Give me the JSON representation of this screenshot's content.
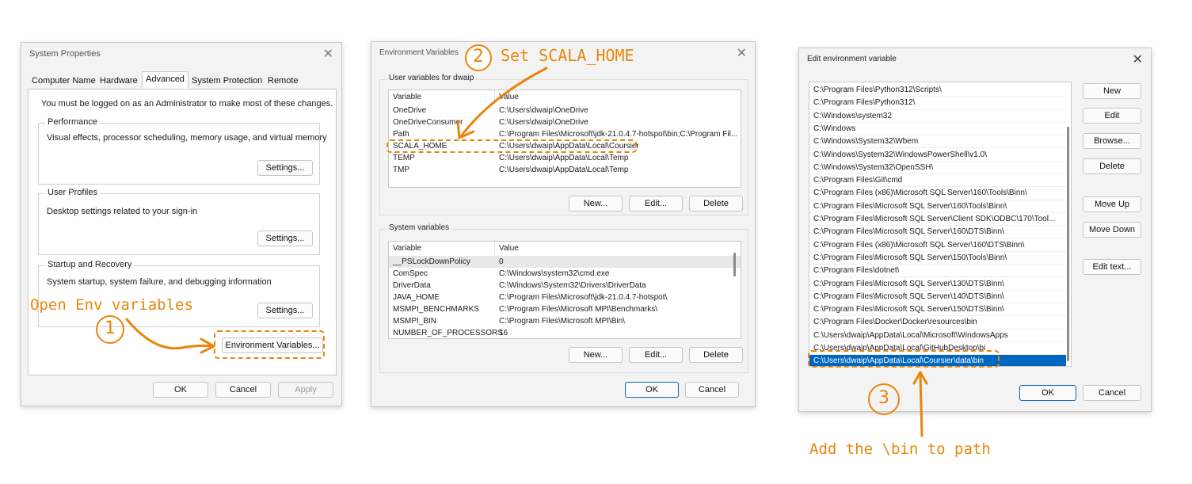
{
  "accent": "#e8860c",
  "select_blue": "#0067c0",
  "sys_props": {
    "title": "System Properties",
    "tabs": [
      "Computer Name",
      "Hardware",
      "Advanced",
      "System Protection",
      "Remote"
    ],
    "active_tab": "Advanced",
    "admin_note": "You must be logged on as an Administrator to make most of these changes.",
    "performance": {
      "label": "Performance",
      "desc": "Visual effects, processor scheduling, memory usage, and virtual memory",
      "button": "Settings..."
    },
    "user_profiles": {
      "label": "User Profiles",
      "desc": "Desktop settings related to your sign-in",
      "button": "Settings..."
    },
    "startup": {
      "label": "Startup and Recovery",
      "desc": "System startup, system failure, and debugging information",
      "button": "Settings..."
    },
    "env_button": "Environment Variables...",
    "ok": "OK",
    "cancel": "Cancel",
    "apply": "Apply"
  },
  "env_vars": {
    "title": "Environment Variables",
    "user_label": "User variables for dwaip",
    "col_var": "Variable",
    "col_val": "Value",
    "user_rows": [
      {
        "name": "OneDrive",
        "value": "C:\\Users\\dwaip\\OneDrive"
      },
      {
        "name": "OneDriveConsumer",
        "value": "C:\\Users\\dwaip\\OneDrive"
      },
      {
        "name": "Path",
        "value": "C:\\Program Files\\Microsoft\\jdk-21.0.4.7-hotspot\\bin;C:\\Program Fil..."
      },
      {
        "name": "SCALA_HOME",
        "value": "C:\\Users\\dwaip\\AppData\\Local\\Coursier"
      },
      {
        "name": "TEMP",
        "value": "C:\\Users\\dwaip\\AppData\\Local\\Temp"
      },
      {
        "name": "TMP",
        "value": "C:\\Users\\dwaip\\AppData\\Local\\Temp"
      }
    ],
    "system_label": "System variables",
    "system_rows": [
      {
        "name": "__PSLockDownPolicy",
        "value": "0"
      },
      {
        "name": "ComSpec",
        "value": "C:\\Windows\\system32\\cmd.exe"
      },
      {
        "name": "DriverData",
        "value": "C:\\Windows\\System32\\Drivers\\DriverData"
      },
      {
        "name": "JAVA_HOME",
        "value": "C:\\Program Files\\Microsoft\\jdk-21.0.4.7-hotspot\\"
      },
      {
        "name": "MSMPI_BENCHMARKS",
        "value": "C:\\Program Files\\Microsoft MPI\\Benchmarks\\"
      },
      {
        "name": "MSMPI_BIN",
        "value": "C:\\Program Files\\Microsoft MPI\\Bin\\"
      },
      {
        "name": "NUMBER_OF_PROCESSORS",
        "value": "16"
      }
    ],
    "new": "New...",
    "edit": "Edit...",
    "delete": "Delete",
    "ok": "OK",
    "cancel": "Cancel"
  },
  "edit_env": {
    "title": "Edit environment variable",
    "paths": [
      "C:\\Program Files\\Python312\\Scripts\\",
      "C:\\Program Files\\Python312\\",
      "C:\\Windows\\system32",
      "C:\\Windows",
      "C:\\Windows\\System32\\Wbem",
      "C:\\Windows\\System32\\WindowsPowerShell\\v1.0\\",
      "C:\\Windows\\System32\\OpenSSH\\",
      "C:\\Program Files\\Git\\cmd",
      "C:\\Program Files (x86)\\Microsoft SQL Server\\160\\Tools\\Binn\\",
      "C:\\Program Files\\Microsoft SQL Server\\160\\Tools\\Binn\\",
      "C:\\Program Files\\Microsoft SQL Server\\Client SDK\\ODBC\\170\\Tool...",
      "C:\\Program Files\\Microsoft SQL Server\\160\\DTS\\Binn\\",
      "C:\\Program Files (x86)\\Microsoft SQL Server\\160\\DTS\\Binn\\",
      "C:\\Program Files\\Microsoft SQL Server\\150\\Tools\\Binn\\",
      "C:\\Program Files\\dotnet\\",
      "C:\\Program Files\\Microsoft SQL Server\\130\\DTS\\Binn\\",
      "C:\\Program Files\\Microsoft SQL Server\\140\\DTS\\Binn\\",
      "C:\\Program Files\\Microsoft SQL Server\\150\\DTS\\Binn\\",
      "C:\\Program Files\\Docker\\Docker\\resources\\bin",
      "C:\\Users\\dwaip\\AppData\\Local\\Microsoft\\WindowsApps",
      "C:\\Users\\dwaip\\AppData\\Local\\GitHubDesktop\\bi",
      "C:\\Users\\dwaip\\AppData\\Local\\Coursier\\data\\bin"
    ],
    "selected_index": 21,
    "buttons": {
      "new": "New",
      "edit": "Edit",
      "browse": "Browse...",
      "delete": "Delete",
      "move_up": "Move Up",
      "move_down": "Move Down",
      "edit_text": "Edit text..."
    },
    "ok": "OK",
    "cancel": "Cancel"
  },
  "annotations": {
    "step1_num": "1",
    "step1_text": "Open Env variables",
    "step2_num": "2",
    "step2_text": "Set SCALA_HOME",
    "step3_num": "3",
    "step3_text": "Add the \\bin to path"
  },
  "close_glyph": "✕"
}
